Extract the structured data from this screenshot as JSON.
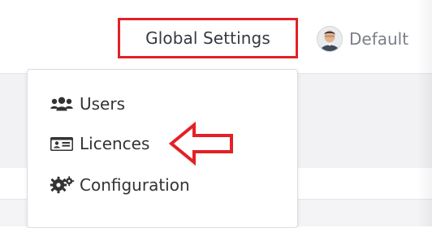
{
  "header": {
    "global_settings_label": "Global Settings",
    "user_name": "Default"
  },
  "dropdown": {
    "items": [
      {
        "label": "Users",
        "icon": "users-icon"
      },
      {
        "label": "Licences",
        "icon": "id-card-icon"
      },
      {
        "label": "Configuration",
        "icon": "cogs-icon"
      }
    ]
  },
  "colors": {
    "highlight_red": "#e32126",
    "text_dark": "#343a40",
    "text_muted": "#7a7f86"
  }
}
